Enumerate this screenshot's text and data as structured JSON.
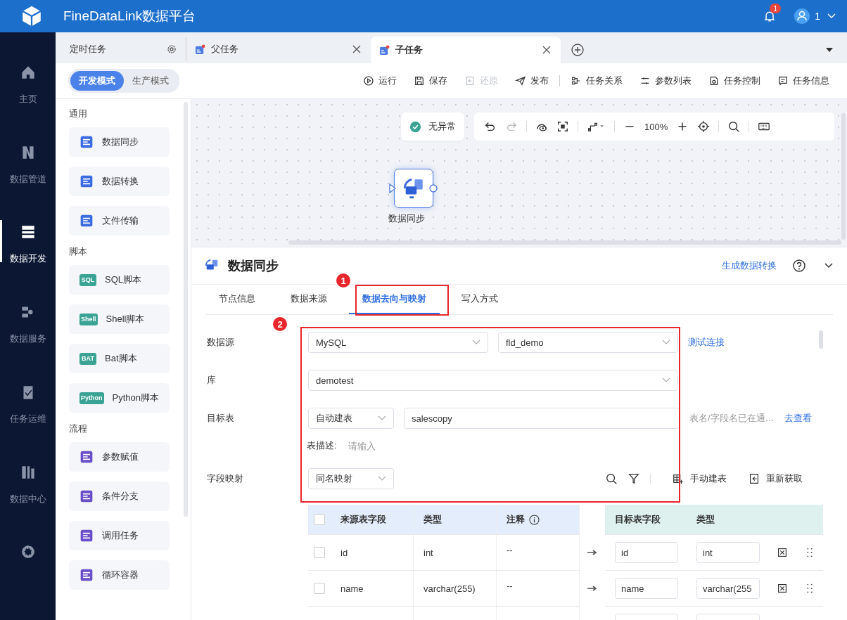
{
  "header": {
    "title": "FineDataLink数据平台",
    "badge": "1",
    "user": "1"
  },
  "nav": [
    {
      "label": "主页",
      "selected": false
    },
    {
      "label": "数据管道",
      "selected": false
    },
    {
      "label": "数据开发",
      "selected": true
    },
    {
      "label": "数据服务",
      "selected": false
    },
    {
      "label": "任务运维",
      "selected": false
    },
    {
      "label": "数据中心",
      "selected": false
    }
  ],
  "tabs": [
    {
      "label": "定时任务",
      "kind": "settings",
      "selected": false
    },
    {
      "label": "父任务",
      "kind": "task",
      "selected": false
    },
    {
      "label": "子任务",
      "kind": "task",
      "selected": true
    }
  ],
  "modes": [
    {
      "label": "开发模式",
      "selected": true
    },
    {
      "label": "生产模式",
      "selected": false
    }
  ],
  "action_groups": [
    [
      {
        "label": "运行",
        "disabled": false
      },
      {
        "label": "保存",
        "disabled": false
      },
      {
        "label": "还原",
        "disabled": true
      },
      {
        "label": "发布",
        "disabled": false
      }
    ],
    [
      {
        "label": "任务关系",
        "disabled": false
      },
      {
        "label": "参数列表",
        "disabled": false
      },
      {
        "label": "任务控制",
        "disabled": false
      },
      {
        "label": "任务信息",
        "disabled": false
      }
    ]
  ],
  "palette": [
    {
      "title": "通用",
      "color": "#3d6ce0",
      "items": [
        {
          "label": "数据同步"
        },
        {
          "label": "数据转换"
        },
        {
          "label": "文件传输"
        }
      ]
    },
    {
      "title": "脚本",
      "color": "#3aa394",
      "items": [
        {
          "label": "SQL脚本",
          "icon_text": "SQL"
        },
        {
          "label": "Shell脚本",
          "icon_text": "Shell"
        },
        {
          "label": "Bat脚本",
          "icon_text": "BAT"
        },
        {
          "label": "Python脚本",
          "icon_text": "Python"
        }
      ]
    },
    {
      "title": "流程",
      "color": "#6a4fc9",
      "items": [
        {
          "label": "参数赋值"
        },
        {
          "label": "条件分支"
        },
        {
          "label": "调用任务"
        },
        {
          "label": "循环容器"
        }
      ]
    }
  ],
  "canvas": {
    "status": "无异常",
    "zoom": "100%",
    "node": {
      "label": "数据同步"
    }
  },
  "panel": {
    "title": "数据同步",
    "link": "生成数据转换",
    "tabs": [
      {
        "label": "节点信息",
        "selected": false
      },
      {
        "label": "数据来源",
        "selected": false
      },
      {
        "label": "数据去向与映射",
        "selected": true
      },
      {
        "label": "写入方式",
        "selected": false
      }
    ],
    "form": {
      "source_label": "数据源",
      "source_type": "MySQL",
      "connection": "fld_demo",
      "test_link": "测试连接",
      "db_label": "库",
      "database": "demotest",
      "target_label": "目标表",
      "create_mode": "自动建表",
      "table_name": "salescopy",
      "hint": "表名/字段名已在通…",
      "view_link": "去查看",
      "desc_label": "表描述:",
      "desc_placeholder": "请输入",
      "mapping_label": "字段映射",
      "mapping_mode": "同名映射",
      "manual_create": "手动建表",
      "refresh": "重新获取"
    },
    "mapping": {
      "all_checked": false,
      "source_columns": [
        "来源表字段",
        "类型",
        "注释"
      ],
      "target_columns": [
        "目标表字段",
        "类型"
      ],
      "rows": [
        {
          "checked": false,
          "source_field": "id",
          "source_type": "int",
          "comment": "--",
          "target_field": "id",
          "target_type": "int"
        },
        {
          "checked": false,
          "source_field": "name",
          "source_type": "varchar(255)",
          "comment": "--",
          "target_field": "name",
          "target_type": "varchar(255"
        }
      ]
    }
  },
  "annotations": [
    "1",
    "2"
  ]
}
